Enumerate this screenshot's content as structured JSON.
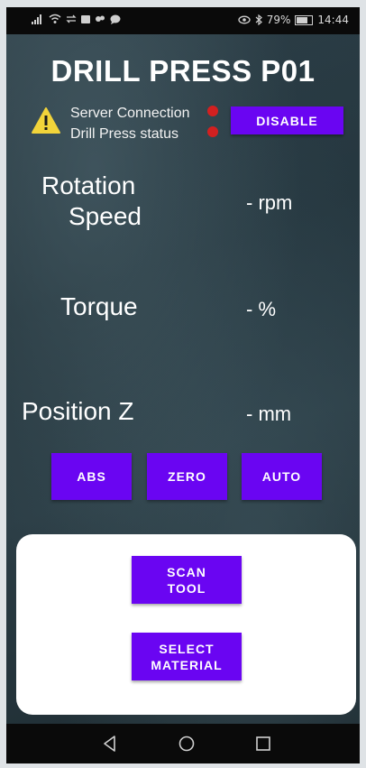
{
  "status_bar": {
    "left_icons": [
      "signal-icon",
      "wifi-icon",
      "data-icon",
      "mail-icon",
      "link-icon",
      "chat-icon"
    ],
    "battery_percent": "79%",
    "time": "14:44"
  },
  "header": {
    "title": "DRILL PRESS P01"
  },
  "connection": {
    "server_label": "Server Connection",
    "drill_label": "Drill Press status",
    "server_status_color": "#d32020",
    "drill_status_color": "#d32020",
    "disable_button": "DISABLE"
  },
  "metrics": {
    "rotation_label_line1": "Rotation",
    "rotation_label_line2": "Speed",
    "rotation_value": "- rpm",
    "torque_label": "Torque",
    "torque_value": "- %",
    "position_label": "Position Z",
    "position_value": "- mm"
  },
  "controls": {
    "abs": "ABS",
    "zero": "ZERO",
    "auto": "AUTO"
  },
  "card": {
    "scan_line1": "SCAN",
    "scan_line2": "TOOL",
    "select_line1": "SELECT",
    "select_line2": "MATERIAL"
  },
  "colors": {
    "accent": "#6a05f2",
    "status_red": "#d32020"
  }
}
